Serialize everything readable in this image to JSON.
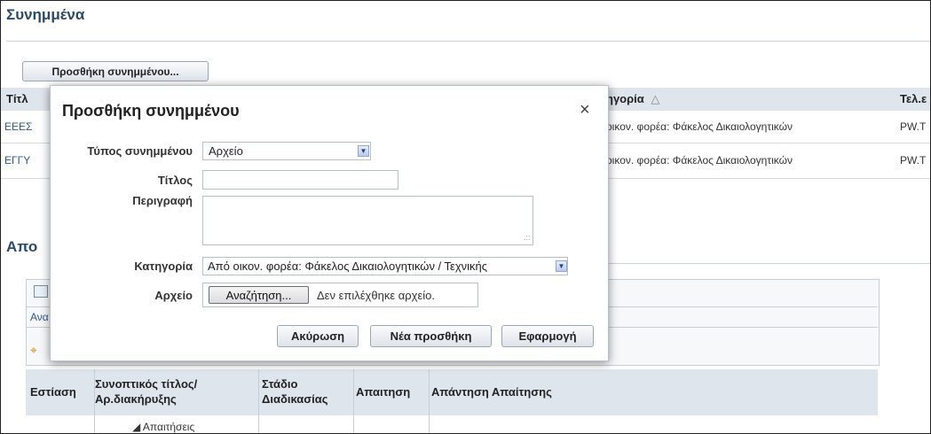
{
  "page": {
    "section_title": "Συνημμένα",
    "add_button": "Προσθήκη συνημμένου...",
    "table": {
      "col_title": "Τίτλ",
      "col_category": "ηγορία",
      "sort_icon": "△",
      "col_end": "Τελ.ε",
      "rows": [
        {
          "title": "ΕΕΕΣ",
          "category": "οικον. φορέα: Φάκελος Δικαιολογητικών",
          "end": "PW.T"
        },
        {
          "title": "ΕΓΓΥ",
          "category": "οικον. φορέα: Φάκελος Δικαιολογητικών",
          "end": "PW.T"
        }
      ]
    },
    "section2_title": "Απο",
    "sub_link": "Ανα",
    "bottom_table": {
      "headers": [
        "Εστίαση",
        "Συνοπτικός τίτλος/Αρ.διακήρυξης",
        "Στάδιο Διαδικασίας",
        "Απαιτηση",
        "Απάντηση Απαίτησης"
      ],
      "tree_item": "◢ Απαιτήσεις"
    }
  },
  "dialog": {
    "title": "Προσθήκη συνημμένου",
    "close": "×",
    "type_label": "Τύπος συνημμένου",
    "type_value": "Αρχείο",
    "title_label": "Τίτλος",
    "title_value": "",
    "desc_label": "Περιγραφή",
    "desc_value": "",
    "category_label": "Κατηγορία",
    "category_value": "Από οικον. φορέα: Φάκελος Δικαιολογητικών / Τεχνικής",
    "file_label": "Αρχείο",
    "browse_button": "Αναζήτηση...",
    "no_file_text": "Δεν επιλέχθηκε αρχείο.",
    "cancel_button": "Ακύρωση",
    "new_add_button": "Νέα προσθήκη",
    "apply_button": "Εφαρμογή"
  }
}
